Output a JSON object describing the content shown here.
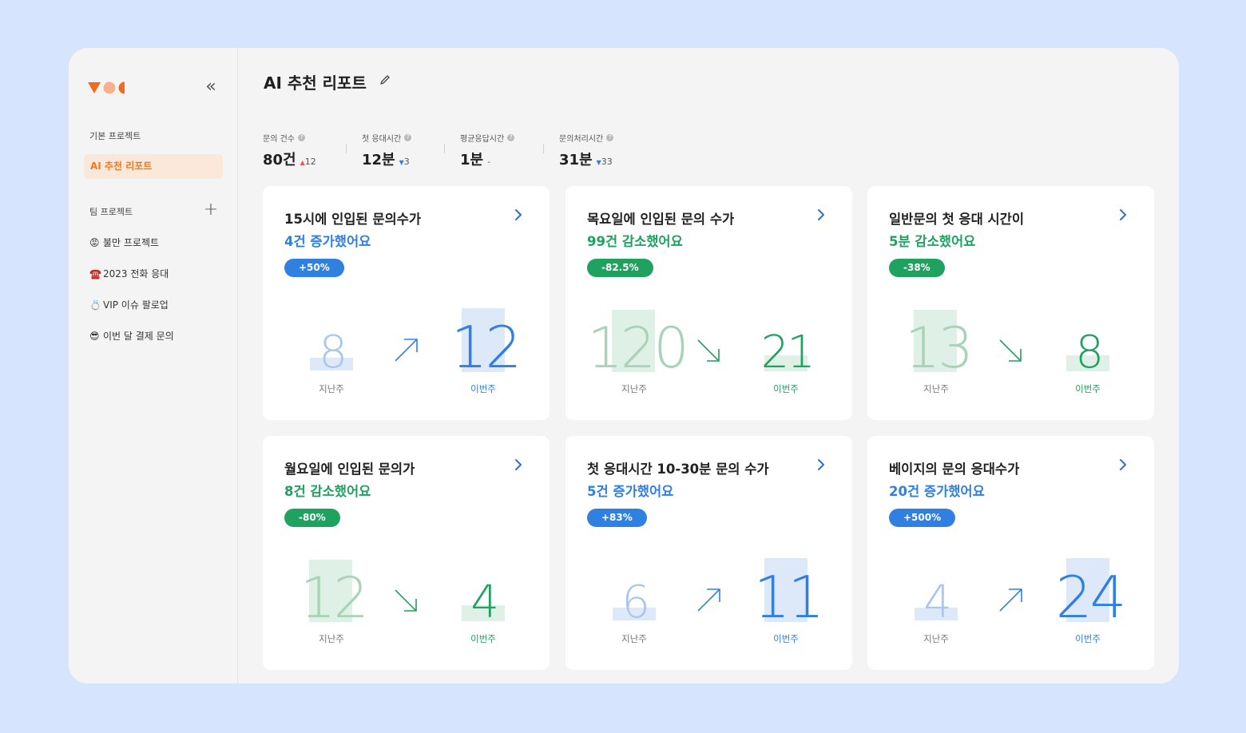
{
  "sidebar": {
    "base_section": "기본 프로젝트",
    "active_item": "AI 추천 리포트",
    "team_section": "팀 프로젝트",
    "items": [
      {
        "emoji": "😡",
        "label": "불만 프로젝트"
      },
      {
        "emoji": "☎️",
        "label": "2023 전화 응대"
      },
      {
        "emoji": "💍",
        "label": "VIP 이슈 팔로업"
      },
      {
        "emoji": "😎",
        "label": "이번 달 결제 문의"
      }
    ]
  },
  "header": {
    "title": "AI 추천 리포트"
  },
  "stats": [
    {
      "label": "문의 건수",
      "value": "80건",
      "delta_dir": "up",
      "delta": "12"
    },
    {
      "label": "첫 응대시간",
      "value": "12분",
      "delta_dir": "down",
      "delta": "3"
    },
    {
      "label": "평균응답시간",
      "value": "1분",
      "delta_dir": "none",
      "delta": "-"
    },
    {
      "label": "문의처리시간",
      "value": "31분",
      "delta_dir": "down",
      "delta": "33"
    }
  ],
  "colors": {
    "blue": "#2f80e0",
    "green": "#1fa15f",
    "orange": "#f27a1a"
  },
  "cards": [
    {
      "title": "15시에 인입된 문의수가",
      "subtitle": "4건 증가했어요",
      "badge": "+50%",
      "tone": "blue",
      "prev": "8",
      "curr": "12",
      "prev_label": "지난주",
      "curr_label": "이번주"
    },
    {
      "title": "목요일에 인입된 문의 수가",
      "subtitle": "99건 감소했어요",
      "badge": "-82.5%",
      "tone": "green",
      "prev": "120",
      "curr": "21",
      "prev_label": "지난주",
      "curr_label": "이번주"
    },
    {
      "title": "일반문의 첫 응대 시간이",
      "subtitle": "5분 감소했어요",
      "badge": "-38%",
      "tone": "green",
      "prev": "13",
      "curr": "8",
      "prev_label": "지난주",
      "curr_label": "이번주"
    },
    {
      "title": "월요일에 인입된 문의가",
      "subtitle": "8건 감소했어요",
      "badge": "-80%",
      "tone": "green",
      "prev": "12",
      "curr": "4",
      "prev_label": "지난주",
      "curr_label": "이번주"
    },
    {
      "title": "첫 응대시간 10-30분 문의 수가",
      "subtitle": "5건 증가했어요",
      "badge": "+83%",
      "tone": "blue",
      "prev": "6",
      "curr": "11",
      "prev_label": "지난주",
      "curr_label": "이번주"
    },
    {
      "title": "베이지의 문의 응대수가",
      "subtitle": "20건 증가했어요",
      "badge": "+500%",
      "tone": "blue",
      "prev": "4",
      "curr": "24",
      "prev_label": "지난주",
      "curr_label": "이번주"
    }
  ]
}
